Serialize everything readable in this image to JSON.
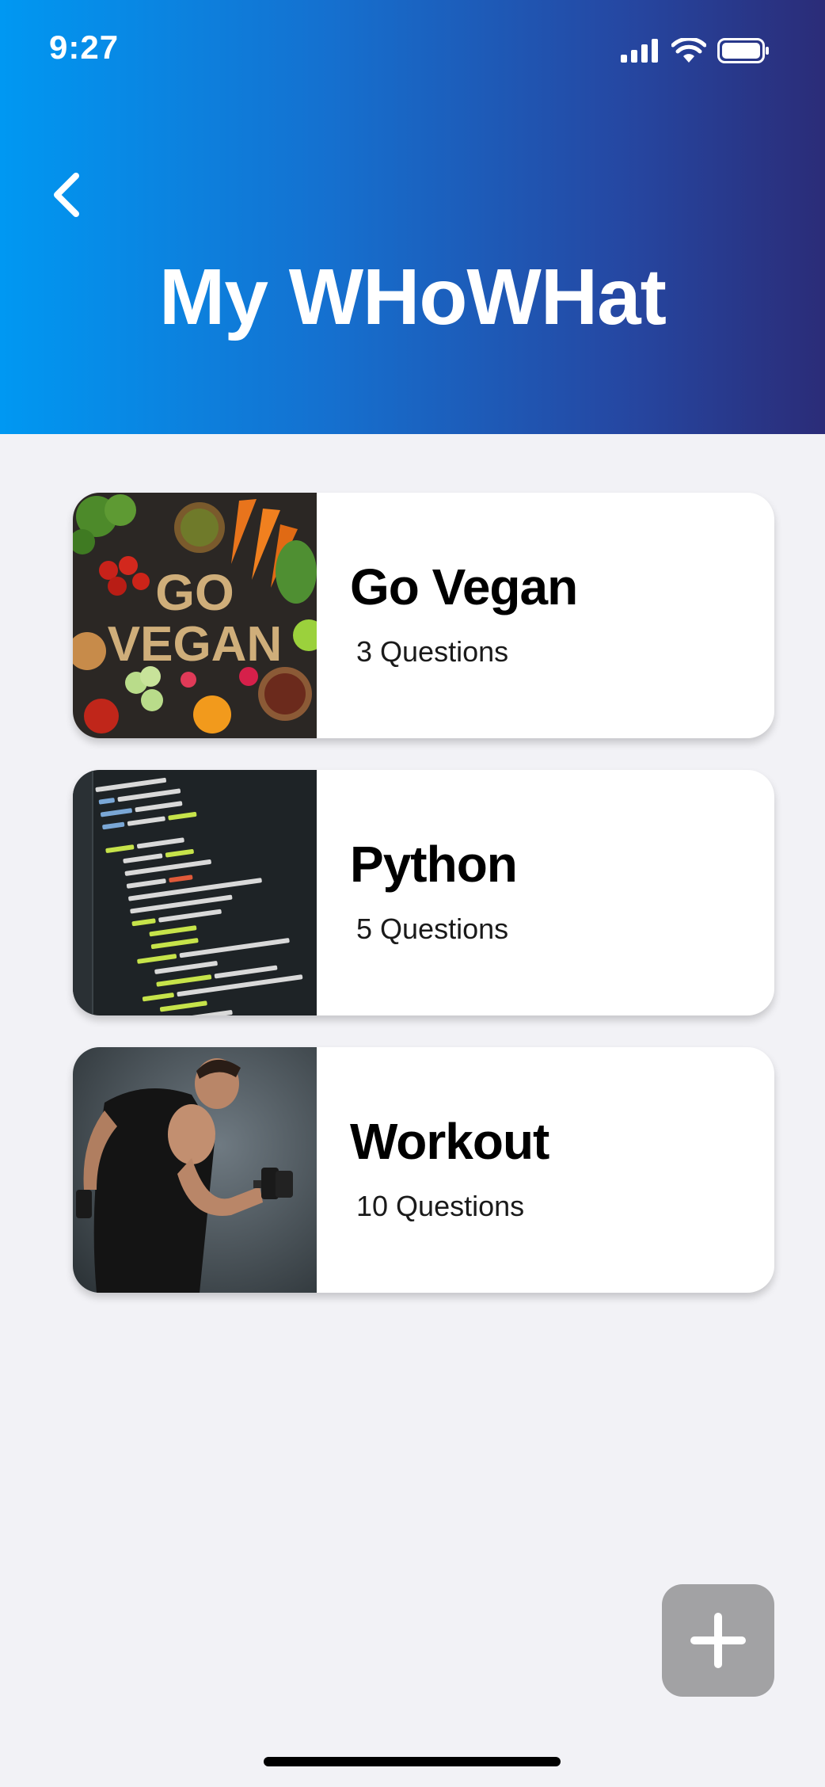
{
  "status_bar": {
    "time": "9:27"
  },
  "header": {
    "title": "My WHoWHat",
    "back_icon": "chevron-left-icon"
  },
  "quizzes": [
    {
      "title": "Go Vegan",
      "subtitle": "3 Questions",
      "image": "vegan-vegetables-image",
      "image_text": "GO VEGAN"
    },
    {
      "title": "Python",
      "subtitle": "5 Questions",
      "image": "code-screen-image"
    },
    {
      "title": "Workout",
      "subtitle": "10 Questions",
      "image": "dumbbell-athlete-image"
    }
  ],
  "fab": {
    "icon": "plus-icon"
  },
  "colors": {
    "header_gradient_start": "#0098f2",
    "header_gradient_end": "#2b2c78",
    "background": "#f2f2f6",
    "fab": "#a2a2a4"
  }
}
